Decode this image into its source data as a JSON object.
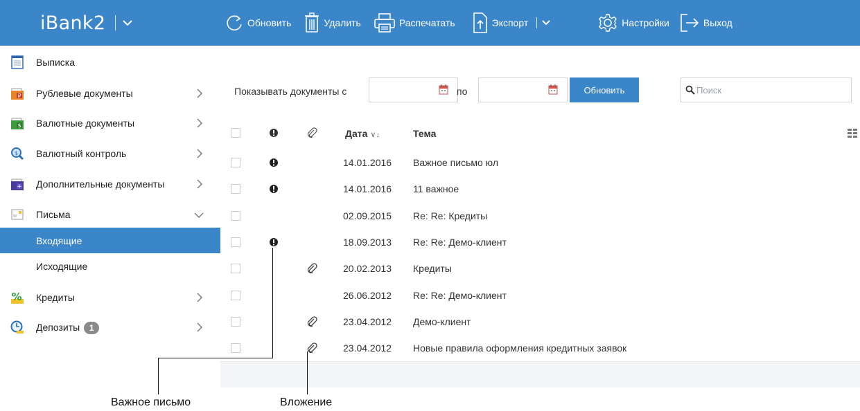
{
  "app": {
    "title": "iBank2"
  },
  "toolbar": {
    "refresh": "Обновить",
    "delete": "Удалить",
    "print": "Распечатать",
    "export": "Экспорт",
    "settings": "Настройки",
    "logout": "Выход"
  },
  "sidebar": {
    "items": [
      {
        "label": "Выписка"
      },
      {
        "label": "Рублевые документы"
      },
      {
        "label": "Валютные документы"
      },
      {
        "label": "Валютный контроль"
      },
      {
        "label": "Дополнительные документы"
      },
      {
        "label": "Письма"
      },
      {
        "label": "Входящие"
      },
      {
        "label": "Исходящие"
      },
      {
        "label": "Кредиты"
      },
      {
        "label": "Депозиты",
        "badge": "1"
      }
    ]
  },
  "filter": {
    "label": "Показывать документы с",
    "to_label": "по",
    "from_value": "",
    "to_value": "",
    "refresh_label": "Обновить",
    "search_placeholder": "Поиск"
  },
  "table": {
    "headers": {
      "date": "Дата",
      "sort": "∨↓",
      "topic": "Тема"
    },
    "rows": [
      {
        "date": "14.01.2016",
        "topic": "Важное письмо юл",
        "important": true,
        "attachment": false
      },
      {
        "date": "14.01.2016",
        "topic": "11 важное",
        "important": true,
        "attachment": false
      },
      {
        "date": "02.09.2015",
        "topic": "Re: Re: Кредиты",
        "important": false,
        "attachment": false
      },
      {
        "date": "18.09.2013",
        "topic": "Re: Re: Демо-клиент",
        "important": true,
        "attachment": false
      },
      {
        "date": "20.02.2013",
        "topic": "Кредиты",
        "important": false,
        "attachment": true
      },
      {
        "date": "26.06.2012",
        "topic": "Re: Re: Демо-клиент",
        "important": false,
        "attachment": false
      },
      {
        "date": "23.04.2012",
        "topic": "Демо-клиент",
        "important": false,
        "attachment": true
      },
      {
        "date": "23.04.2012",
        "topic": "Новые правила оформления кредитных заявок",
        "important": false,
        "attachment": true
      }
    ]
  },
  "callouts": {
    "important": "Важное письмо",
    "attachment": "Вложение"
  },
  "colors": {
    "accent": "#3a86c9",
    "badge": "#8a8a8a"
  }
}
